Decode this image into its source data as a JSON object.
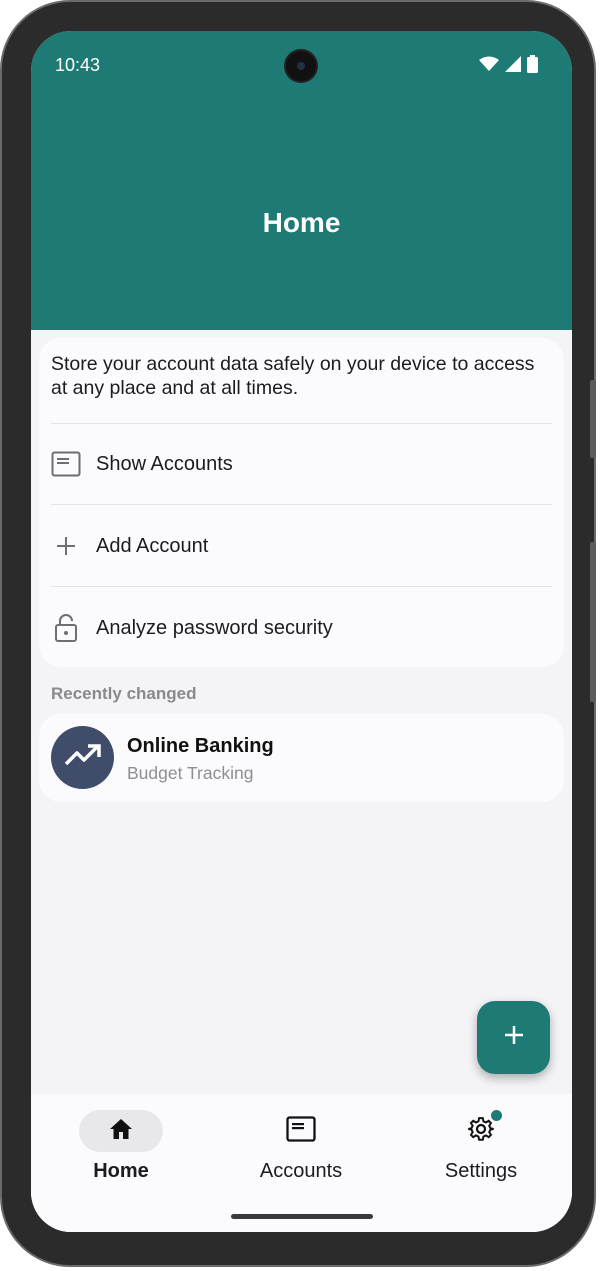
{
  "status_bar": {
    "time": "10:43"
  },
  "header": {
    "title": "Home"
  },
  "card": {
    "intro": "Store your account data safely on your device to access at any place and at all times.",
    "items": [
      {
        "label": "Show Accounts",
        "icon": "account-card-icon"
      },
      {
        "label": "Add Account",
        "icon": "plus-icon"
      },
      {
        "label": "Analyze password security",
        "icon": "unlocked-padlock-icon"
      }
    ]
  },
  "recent": {
    "section_title": "Recently changed",
    "items": [
      {
        "title": "Online Banking",
        "subtitle": "Budget Tracking",
        "icon": "trending-up-icon"
      }
    ]
  },
  "fab": {
    "icon": "plus-icon"
  },
  "bottom_nav": {
    "items": [
      {
        "label": "Home",
        "icon": "home-icon",
        "active": true
      },
      {
        "label": "Accounts",
        "icon": "account-card-icon",
        "active": false
      },
      {
        "label": "Settings",
        "icon": "gear-icon",
        "active": false,
        "badge": true
      }
    ]
  },
  "colors": {
    "primary": "#1e7a74",
    "avatar": "#3f4d6b",
    "background": "#f4f4f7",
    "card": "#fbfbfd"
  }
}
